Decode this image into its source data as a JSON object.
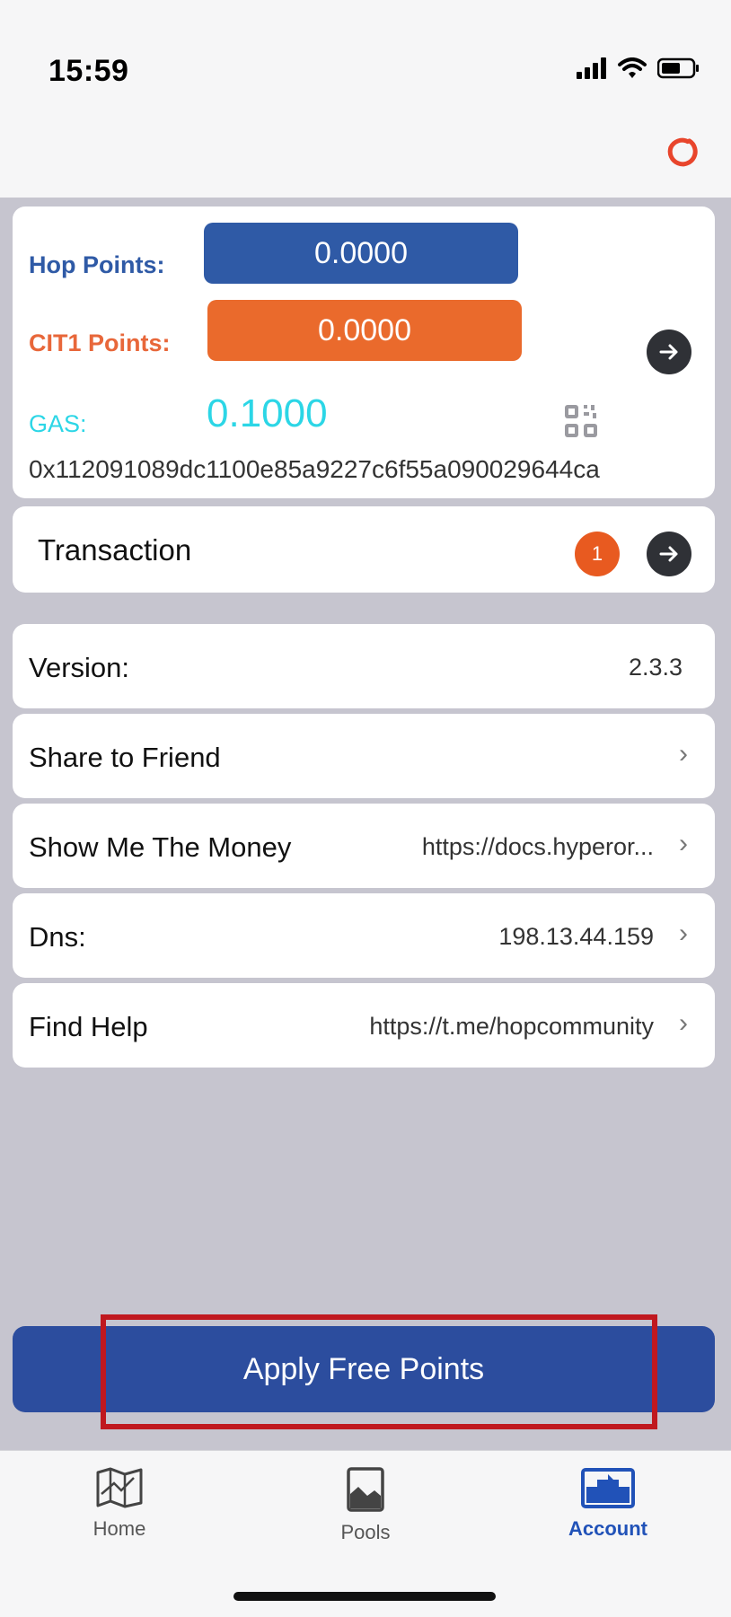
{
  "status_bar": {
    "time": "15:59"
  },
  "header": {
    "refresh_icon": "refresh-icon",
    "accent_color": "#e8452c"
  },
  "account_card": {
    "hop_label": "Hop Points:",
    "hop_value": "0.0000",
    "cit1_label": "CIT1 Points:",
    "cit1_value": "0.0000",
    "gas_label": "GAS:",
    "gas_value": "0.1000",
    "address": "0x112091089dc1100e85a9227c6f55a090029644ca"
  },
  "transaction": {
    "label": "Transaction",
    "badge_count": "1"
  },
  "settings": {
    "version_label": "Version:",
    "version_value": "2.3.3",
    "share_label": "Share to Friend",
    "money_label": "Show Me The Money",
    "money_value": "https://docs.hyperor...",
    "dns_label": "Dns:",
    "dns_value": "198.13.44.159",
    "help_label": "Find Help",
    "help_value": "https://t.me/hopcommunity"
  },
  "apply_button": {
    "label": "Apply Free Points"
  },
  "tabs": [
    {
      "label": "Home",
      "icon": "map-icon",
      "active": false
    },
    {
      "label": "Pools",
      "icon": "pool-icon",
      "active": false
    },
    {
      "label": "Account",
      "icon": "account-icon",
      "active": true
    }
  ],
  "colors": {
    "hop_blue": "#2f5aa6",
    "cit_orange": "#ea6a2c",
    "gas_cyan": "#2cd6e6",
    "button_blue": "#2c4d9e",
    "highlight_red": "#c0181f",
    "active_tab": "#2152b8"
  }
}
